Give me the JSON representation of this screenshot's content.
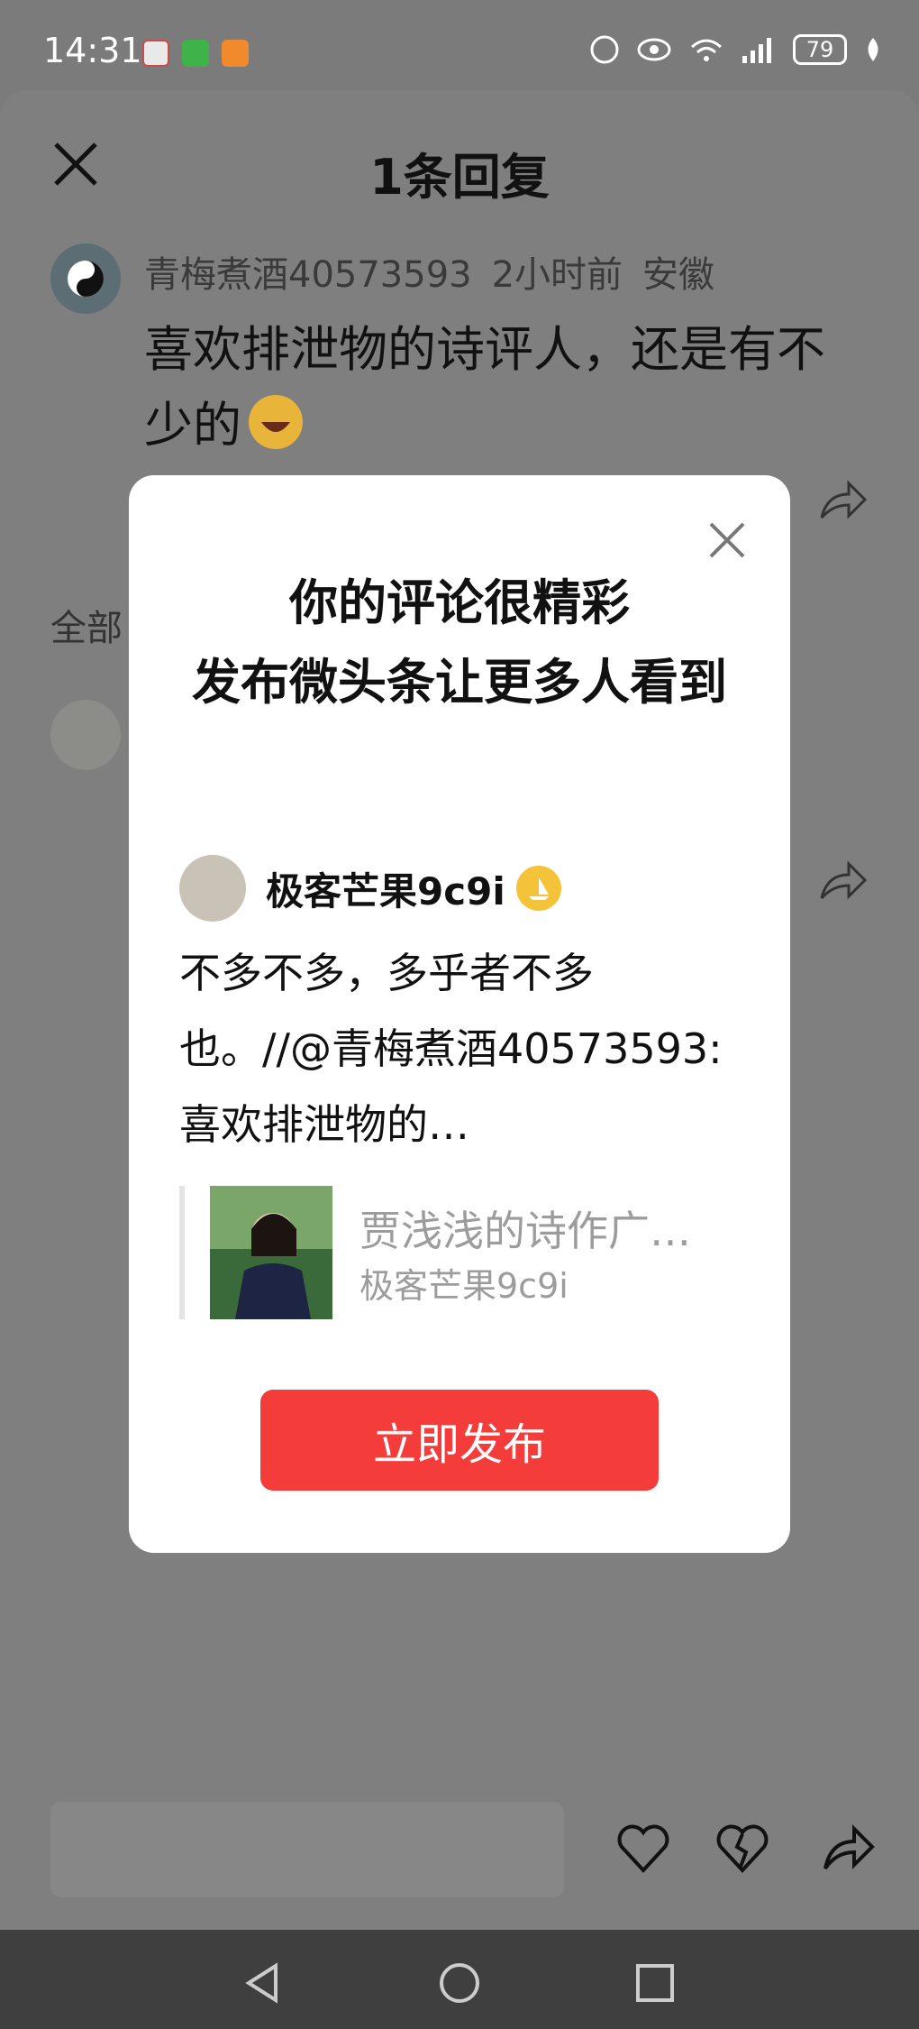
{
  "status_bar": {
    "time": "14:31",
    "battery": "79",
    "app_icons": [
      "toutiao-icon",
      "wechat-icon",
      "orange-app-icon"
    ]
  },
  "sheet": {
    "title": "1条回复",
    "original_comment": {
      "username": "青梅煮酒40573593",
      "time": "2小时前",
      "location": "安徽",
      "text": "喜欢排泄物的诗评人，还是有不少的"
    },
    "section_label": "全部"
  },
  "dialog": {
    "title_line1": "你的评论很精彩",
    "title_line2": "发布微头条让更多人看到",
    "author": "极客芒果9c9i",
    "body": "不多不多，多乎者不多也。//@青梅煮酒40573593:喜欢排泄物的…",
    "quote_title": "贾浅浅的诗作广…",
    "quote_author": "极客芒果9c9i",
    "publish_button": "立即发布"
  },
  "colors": {
    "accent_red": "#f43c3a",
    "badge_yellow": "#f4c33a",
    "overlay_gray": "#7b7b7b"
  }
}
